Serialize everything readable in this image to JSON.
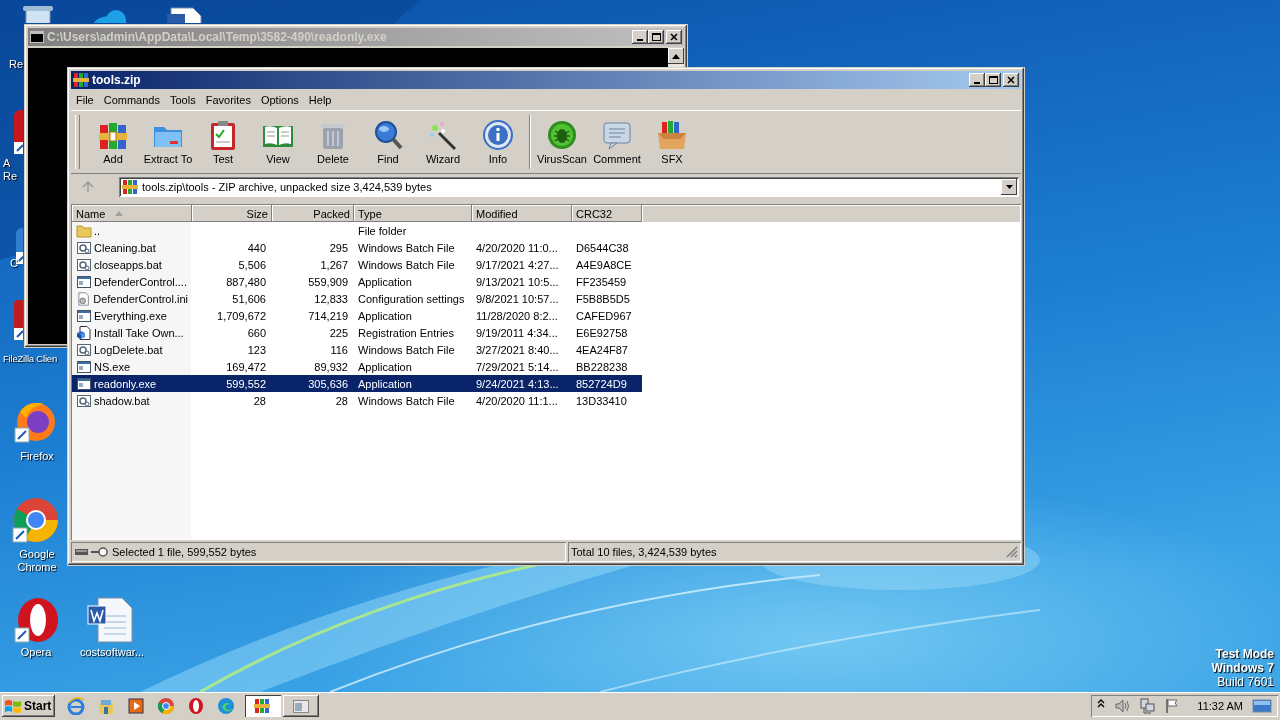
{
  "desktop": {
    "wallpaper": {
      "kind": "picture"
    },
    "icons": [
      {
        "kind": "recycle"
      },
      {
        "kind": "cloud"
      },
      {
        "kind": "document"
      },
      {
        "kind": "pdf",
        "label": "A\nRe"
      },
      {
        "kind": "cleaner",
        "label": "C"
      },
      {
        "kind": "ftp",
        "label": "FileZilla Clien"
      },
      {
        "kind": "firefox",
        "label": "Firefox"
      },
      {
        "kind": "chrome",
        "label": "Google Chrome"
      },
      {
        "kind": "opera",
        "label": "Opera"
      },
      {
        "kind": "word",
        "label": "costsoftwar..."
      }
    ],
    "recycle_label": "Re",
    "edition_text": [
      "Test Mode",
      "Windows 7",
      "Build 7601"
    ]
  },
  "console_window": {
    "title": "C:\\Users\\admin\\AppData\\Local\\Temp\\3582-490\\readonly.exe",
    "active": false
  },
  "archive_window": {
    "title": "tools.zip",
    "active": true,
    "menu": [
      "File",
      "Commands",
      "Tools",
      "Favorites",
      "Options",
      "Help"
    ],
    "toolbar_groups": [
      [
        {
          "label": "Add",
          "kind": "add"
        },
        {
          "label": "Extract To",
          "kind": "extract"
        },
        {
          "label": "Test",
          "kind": "test"
        },
        {
          "label": "View",
          "kind": "view"
        },
        {
          "label": "Delete",
          "kind": "delete"
        },
        {
          "label": "Find",
          "kind": "find"
        },
        {
          "label": "Wizard",
          "kind": "wizard"
        },
        {
          "label": "Info",
          "kind": "info"
        }
      ],
      [
        {
          "label": "VirusScan",
          "kind": "virusscan"
        },
        {
          "label": "Comment",
          "kind": "comment"
        },
        {
          "label": "SFX",
          "kind": "sfx"
        }
      ]
    ],
    "up_disabled": true,
    "path": "tools.zip\\tools - ZIP archive, unpacked size 3,424,539 bytes",
    "columns": [
      {
        "label": "Name",
        "sorted": true
      },
      {
        "label": "Size",
        "sorted": false
      },
      {
        "label": "Packed",
        "sorted": false
      },
      {
        "label": "Type",
        "sorted": false
      },
      {
        "label": "Modified",
        "sorted": false
      },
      {
        "label": "CRC32",
        "sorted": false
      }
    ],
    "rows": [
      {
        "kind": "folder",
        "name": "..",
        "type": "File folder",
        "selected": false
      },
      {
        "kind": "batch",
        "name": "Cleaning.bat",
        "size": "440",
        "packed": "295",
        "type": "Windows Batch File",
        "modified": "4/20/2020 11:0...",
        "crc32": "D6544C38",
        "selected": false
      },
      {
        "kind": "batch",
        "name": "closeapps.bat",
        "size": "5,506",
        "packed": "1,267",
        "type": "Windows Batch File",
        "modified": "9/17/2021 4:27...",
        "crc32": "A4E9A8CE",
        "selected": false
      },
      {
        "kind": "app",
        "name": "DefenderControl....",
        "size": "887,480",
        "packed": "559,909",
        "type": "Application",
        "modified": "9/13/2021 10:5...",
        "crc32": "FF235459",
        "selected": false
      },
      {
        "kind": "ini",
        "name": "DefenderControl.ini",
        "size": "51,606",
        "packed": "12,833",
        "type": "Configuration settings",
        "modified": "9/8/2021 10:57...",
        "crc32": "F5B8B5D5",
        "selected": false
      },
      {
        "kind": "app",
        "name": "Everything.exe",
        "size": "1,709,672",
        "packed": "714,219",
        "type": "Application",
        "modified": "11/28/2020 8:2...",
        "crc32": "CAFED967",
        "selected": false
      },
      {
        "kind": "reg",
        "name": "Install Take Own...",
        "size": "660",
        "packed": "225",
        "type": "Registration Entries",
        "modified": "9/19/2011 4:34...",
        "crc32": "E6E92758",
        "selected": false
      },
      {
        "kind": "batch",
        "name": "LogDelete.bat",
        "size": "123",
        "packed": "116",
        "type": "Windows Batch File",
        "modified": "3/27/2021 8:40...",
        "crc32": "4EA24F87",
        "selected": false
      },
      {
        "kind": "app",
        "name": "NS.exe",
        "size": "169,472",
        "packed": "89,932",
        "type": "Application",
        "modified": "7/29/2021 5:14...",
        "crc32": "BB228238",
        "selected": false
      },
      {
        "kind": "app",
        "name": "readonly.exe",
        "size": "599,552",
        "packed": "305,636",
        "type": "Application",
        "modified": "9/24/2021 4:13...",
        "crc32": "852724D9",
        "selected": true
      },
      {
        "kind": "batch",
        "name": "shadow.bat",
        "size": "28",
        "packed": "28",
        "type": "Windows Batch File",
        "modified": "4/20/2020 11:1...",
        "crc32": "13D33410",
        "selected": false
      }
    ],
    "status_left": "Selected 1 file, 599,552 bytes",
    "status_right": "Total 10 files, 3,424,539 bytes"
  },
  "taskbar": {
    "start": "Start",
    "quick_launch": [
      {
        "kind": "ie"
      },
      {
        "kind": "explorer"
      },
      {
        "kind": "media"
      },
      {
        "kind": "chrome"
      },
      {
        "kind": "opera"
      },
      {
        "kind": "edge"
      }
    ],
    "windows": [
      {
        "kind": "archive",
        "pressed": true
      },
      {
        "kind": "console",
        "pressed": false
      }
    ],
    "tray": [
      {
        "kind": "chevron"
      },
      {
        "kind": "speaker"
      },
      {
        "kind": "network"
      },
      {
        "kind": "flag"
      }
    ],
    "clock": "11:32 AM"
  }
}
